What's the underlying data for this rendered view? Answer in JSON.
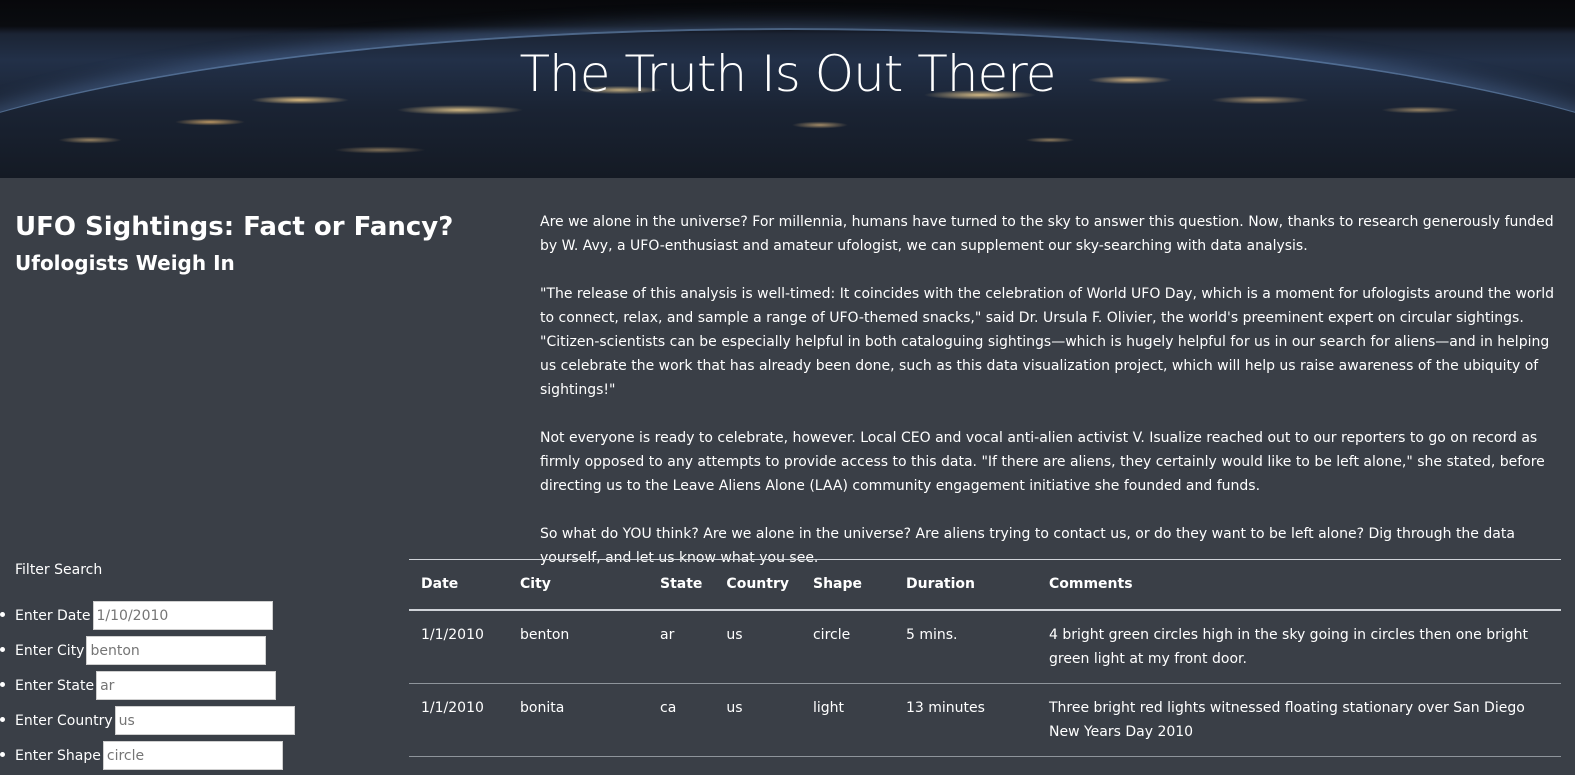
{
  "hero": {
    "title": "The Truth Is Out There"
  },
  "sidebar": {
    "heading": "UFO Sightings: Fact or Fancy?",
    "subheading": "Ufologists Weigh In"
  },
  "article": {
    "paragraphs": [
      "Are we alone in the universe? For millennia, humans have turned to the sky to answer this question. Now, thanks to research generously funded by W. Avy, a UFO-enthusiast and amateur ufologist, we can supplement our sky-searching with data analysis.",
      "\"The release of this analysis is well-timed: It coincides with the celebration of World UFO Day, which is a moment for ufologists around the world to connect, relax, and sample a range of UFO-themed snacks,\" said Dr. Ursula F. Olivier, the world's preeminent expert on circular sightings. \"Citizen-scientists can be especially helpful in both cataloguing sightings—which is hugely helpful for us in our search for aliens—and in helping us celebrate the work that has already been done, such as this data visualization project, which will help us raise awareness of the ubiquity of sightings!\"",
      "Not everyone is ready to celebrate, however. Local CEO and vocal anti-alien activist V. Isualize reached out to our reporters to go on record as firmly opposed to any attempts to provide access to this data. \"If there are aliens, they certainly would like to be left alone,\" she stated, before directing us to the Leave Aliens Alone (LAA) community engagement initiative she founded and funds.",
      "So what do YOU think? Are we alone in the universe? Are aliens trying to contact us, or do they want to be left alone? Dig through the data yourself, and let us know what you see."
    ]
  },
  "filters": {
    "title": "Filter Search",
    "items": [
      {
        "label": "Enter Date",
        "placeholder": "1/10/2010"
      },
      {
        "label": "Enter City",
        "placeholder": "benton"
      },
      {
        "label": "Enter State",
        "placeholder": "ar"
      },
      {
        "label": "Enter Country",
        "placeholder": "us"
      },
      {
        "label": "Enter Shape",
        "placeholder": "circle"
      }
    ]
  },
  "table": {
    "headers": [
      "Date",
      "City",
      "State",
      "Country",
      "Shape",
      "Duration",
      "Comments"
    ],
    "rows": [
      [
        "1/1/2010",
        "benton",
        "ar",
        "us",
        "circle",
        "5 mins.",
        "4 bright green circles high in the sky going in circles then one bright green light at my front door."
      ],
      [
        "1/1/2010",
        "bonita",
        "ca",
        "us",
        "light",
        "13 minutes",
        "Three bright red lights witnessed floating stationary over San Diego New Years Day 2010"
      ]
    ]
  }
}
